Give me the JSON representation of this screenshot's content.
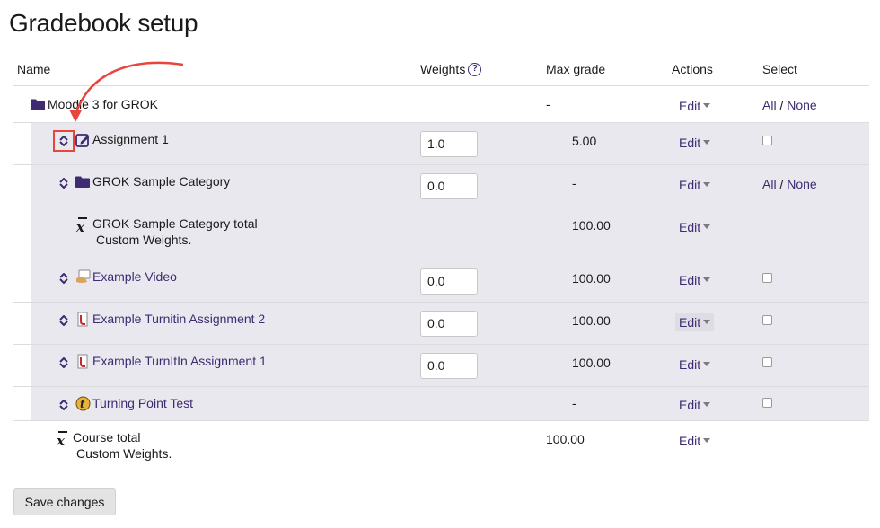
{
  "page": {
    "title": "Gradebook setup"
  },
  "table": {
    "headers": {
      "name": "Name",
      "weights": "Weights",
      "max_grade": "Max grade",
      "actions": "Actions",
      "select": "Select"
    },
    "course": {
      "name": "Moodle 3 for GROK",
      "max_grade": "-",
      "action": "Edit",
      "select_all": "All",
      "select_sep": "/",
      "select_none": "None"
    },
    "rows": [
      {
        "name": "Assignment 1",
        "weight": "1.0",
        "max_grade": "5.00",
        "action": "Edit"
      },
      {
        "name": "GROK Sample Category",
        "weight": "0.0",
        "max_grade": "-",
        "action": "Edit",
        "select_all": "All",
        "select_sep": "/",
        "select_none": "None"
      },
      {
        "name": "GROK Sample Category total",
        "subline": "Custom Weights.",
        "max_grade": "100.00",
        "action": "Edit"
      },
      {
        "name": "Example Video",
        "weight": "0.0",
        "max_grade": "100.00",
        "action": "Edit"
      },
      {
        "name": "Example Turnitin Assignment 2",
        "weight": "0.0",
        "max_grade": "100.00",
        "action": "Edit"
      },
      {
        "name": "Example TurnItIn Assignment 1",
        "weight": "0.0",
        "max_grade": "100.00",
        "action": "Edit"
      },
      {
        "name": "Turning Point Test",
        "max_grade": "-",
        "action": "Edit"
      }
    ],
    "course_total": {
      "name": "Course total",
      "subline": "Custom Weights.",
      "max_grade": "100.00",
      "action": "Edit"
    }
  },
  "footer": {
    "save_label": "Save changes"
  },
  "colors": {
    "brand": "#3e2b72",
    "annotation": "#e8453c",
    "row_shade": "#e9e8ee"
  }
}
